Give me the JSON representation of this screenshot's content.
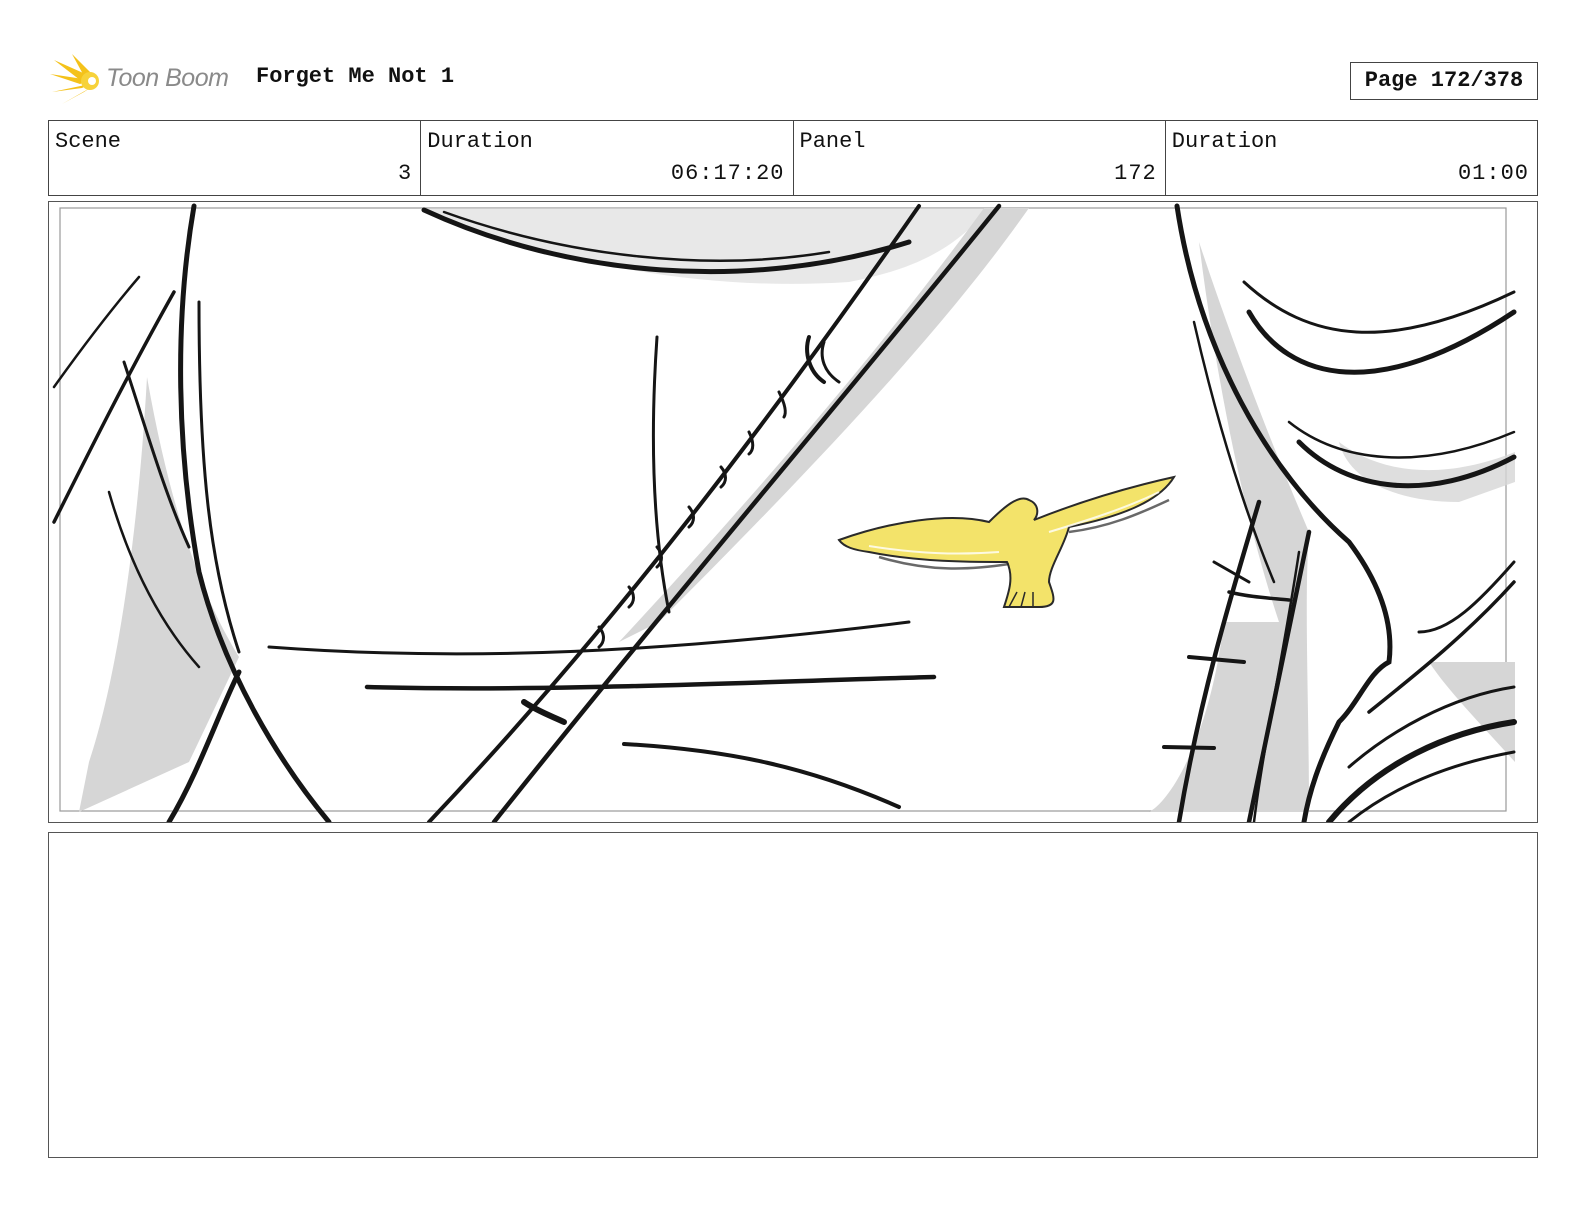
{
  "header": {
    "logo_text": "Toon Boom",
    "logo_icon": "sun-burst-icon",
    "title": "Forget Me Not 1",
    "page_label": "Page 172/378"
  },
  "info": {
    "scene_label": "Scene",
    "scene_value": "3",
    "scene_duration_label": "Duration",
    "scene_duration_value": "06:17:20",
    "panel_label": "Panel",
    "panel_value": "172",
    "panel_duration_label": "Duration",
    "panel_duration_value": "01:00"
  },
  "panel": {
    "description": "",
    "accent_color": "#f3e36a"
  },
  "notes": {
    "text": ""
  }
}
